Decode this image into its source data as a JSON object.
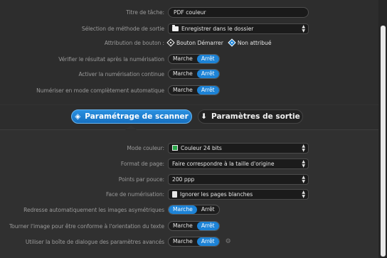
{
  "rows_top": [
    {
      "label": "Titre de tâche:",
      "type": "field",
      "value": "PDF couleur"
    },
    {
      "label": "Sélection de méthode de sortie",
      "type": "select",
      "icon": "folder-icon",
      "value": "Enregistrer dans le dossier"
    },
    {
      "label": "Attribution de bouton :",
      "type": "radio",
      "options": [
        "Bouton Démarrer",
        "Non attribué"
      ],
      "selected": 1
    },
    {
      "label": "Vérifier le résultat après la numérisation",
      "type": "toggle",
      "on_label": "Marche",
      "off_label": "Arrêt",
      "selected": "off"
    },
    {
      "label": "Activer la numérisation continue",
      "type": "toggle",
      "on_label": "Marche",
      "off_label": "Arrêt",
      "selected": "off"
    },
    {
      "label": "Numériser en mode complètement automatique",
      "type": "toggle",
      "on_label": "Marche",
      "off_label": "Arrêt",
      "selected": "off"
    }
  ],
  "tabs": [
    {
      "label": "Paramétrage de scanner",
      "active": true
    },
    {
      "label": "Paramètres de sortie",
      "active": false
    }
  ],
  "rows_bottom": [
    {
      "label": "Mode couleur:",
      "type": "select",
      "icon": "color-icon",
      "value": "Couleur 24 bits"
    },
    {
      "label": "Format de page:",
      "type": "select",
      "icon": "",
      "value": "Faire correspondre à la taille d'origine"
    },
    {
      "label": "Points par pouce:",
      "type": "select",
      "icon": "",
      "value": "200 ppp"
    },
    {
      "label": "Face de numérisation:",
      "type": "select",
      "icon": "pages-icon",
      "value": "Ignorer les pages blanches"
    },
    {
      "label": "Redresse automatiquement les images asymétriques",
      "type": "toggle",
      "on_label": "Marche",
      "off_label": "Arrêt",
      "selected": "on"
    },
    {
      "label": "Tourner l'image pour être conforme à l'orientation du texte",
      "type": "toggle",
      "on_label": "Marche",
      "off_label": "Arrêt",
      "selected": "off"
    },
    {
      "label": "Utiliser la boîte de dialogue des paramètres avancés",
      "type": "toggle",
      "on_label": "Marche",
      "off_label": "Arrêt",
      "selected": "off"
    }
  ],
  "colors": {
    "accent": "#1d83d6",
    "background": "#2d2d2d"
  }
}
